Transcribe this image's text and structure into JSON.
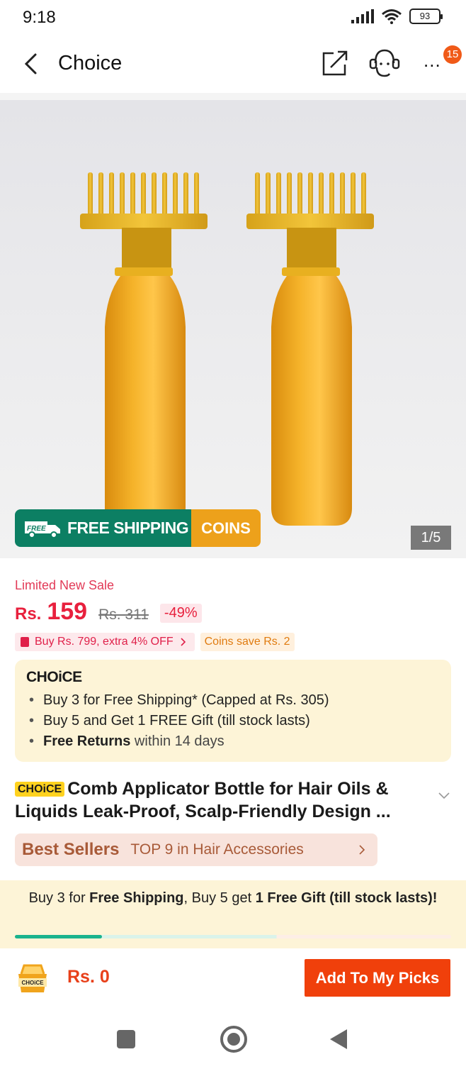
{
  "status_bar": {
    "time": "9:18",
    "battery": "93"
  },
  "header": {
    "title": "Choice",
    "notification_count": "15",
    "more_label": "..."
  },
  "hero": {
    "shipping_badge": "FREE SHIPPING",
    "shipping_icon_text": "FREE",
    "coins_badge": "COINS",
    "pager": "1/5"
  },
  "price": {
    "sale_label": "Limited New Sale",
    "currency": "Rs.",
    "current": "159",
    "original": "Rs. 311",
    "discount": "-49%"
  },
  "promos": {
    "extra_off": "Buy Rs. 799, extra 4% OFF",
    "coins_save": "Coins save Rs. 2"
  },
  "choice_box": {
    "logo": "CHOiCE",
    "line1": "Buy 3 for  Free Shipping* (Capped at Rs. 305)",
    "line2": "Buy 5 and Get 1 FREE Gift (till stock lasts)",
    "line3_bold": "Free Returns",
    "line3_rest": " within 14 days"
  },
  "product": {
    "tag": "CHOiCE",
    "title": "Comb Applicator Bottle for Hair Oils & Liquids Leak-Proof, Scalp-Friendly Design ..."
  },
  "best_sellers": {
    "logo": "Best Sellers",
    "text": "TOP 9 in Hair Accessories"
  },
  "bundle_banner": {
    "p1": "Buy 3 for ",
    "b1": "Free Shipping",
    "p2": ", Buy 5 get ",
    "b2": "1 Free Gift (till stock lasts)!",
    "progress": 0.2
  },
  "bottom_bar": {
    "cart_label": "CHOiCE",
    "total": "Rs. 0",
    "add_button": "Add To My Picks"
  },
  "colors": {
    "accent": "#f0400b",
    "price": "#e8203d",
    "shipping_green": "#0c7f63",
    "coins_orange": "#eda11b",
    "choice_yellow": "#ffd21f"
  }
}
